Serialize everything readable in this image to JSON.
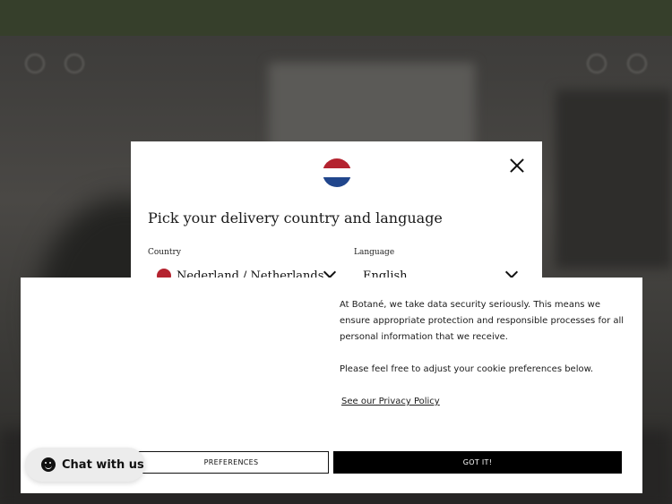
{
  "country_modal": {
    "title": "Pick your delivery country and language",
    "country_label": "Country",
    "country_value": "Nederland / Netherlands",
    "language_label": "Language",
    "language_value": "English"
  },
  "cookie_banner": {
    "paragraph1": "At Botané, we take data security seriously. This means we ensure appropriate protection and responsible processes for all personal information that we receive.",
    "paragraph2": "Please feel free to adjust your cookie preferences below.",
    "privacy_link": "See our Privacy Policy",
    "preferences_label": "PREFERENCES",
    "accept_label": "GOT IT!"
  },
  "chat": {
    "label": "Chat with us"
  },
  "colors": {
    "announce_bg": "#363f2b",
    "flag_red": "#b4232f",
    "flag_blue": "#21468c",
    "accept_bg": "#000000"
  }
}
